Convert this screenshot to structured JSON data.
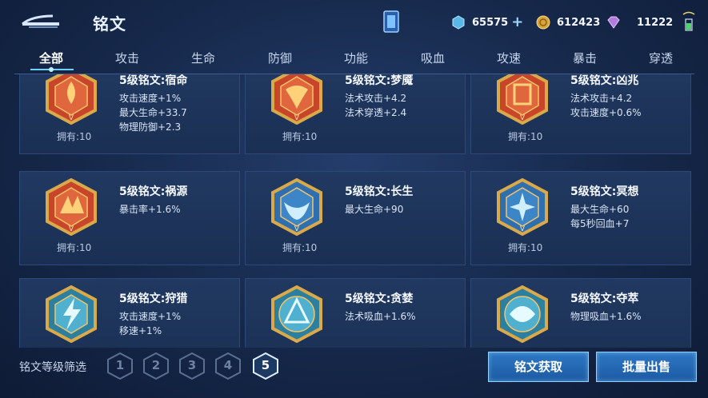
{
  "header": {
    "title": "铭文",
    "currencies": [
      {
        "name": "diamond-icon",
        "value": "65575"
      },
      {
        "name": "gold-coin-icon",
        "value": "612423"
      },
      {
        "name": "gem-icon",
        "value": "11222"
      }
    ]
  },
  "tabs": [
    "全部",
    "攻击",
    "生命",
    "防御",
    "功能",
    "吸血",
    "攻速",
    "暴击",
    "穿透"
  ],
  "active_tab": "全部",
  "runes": [
    {
      "name": "5级铭文:宿命",
      "attrs": [
        "攻击速度+1%",
        "最大生命+33.7",
        "物理防御+2.3"
      ],
      "owned": "拥有:10",
      "icon": "red-rune-icon"
    },
    {
      "name": "5级铭文:梦魇",
      "attrs": [
        "法术攻击+4.2",
        "法术穿透+2.4"
      ],
      "owned": "拥有:10",
      "icon": "red-rune-icon"
    },
    {
      "name": "5级铭文:凶兆",
      "attrs": [
        "法术攻击+4.2",
        "攻击速度+0.6%"
      ],
      "owned": "拥有:10",
      "icon": "red-rune-icon"
    },
    {
      "name": "5级铭文:祸源",
      "attrs": [
        "暴击率+1.6%"
      ],
      "owned": "拥有:10",
      "icon": "red-rune-icon"
    },
    {
      "name": "5级铭文:长生",
      "attrs": [
        "最大生命+90"
      ],
      "owned": "拥有:10",
      "icon": "blue-rune-icon"
    },
    {
      "name": "5级铭文:冥想",
      "attrs": [
        "最大生命+60",
        "每5秒回血+7"
      ],
      "owned": "拥有:10",
      "icon": "blue-rune-icon"
    },
    {
      "name": "5级铭文:狩猎",
      "attrs": [
        "攻击速度+1%",
        "移速+1%"
      ],
      "owned": "",
      "icon": "cyan-rune-icon"
    },
    {
      "name": "5级铭文:贪婪",
      "attrs": [
        "法术吸血+1.6%"
      ],
      "owned": "",
      "icon": "cyan-rune-icon"
    },
    {
      "name": "5级铭文:夺萃",
      "attrs": [
        "物理吸血+1.6%"
      ],
      "owned": "",
      "icon": "cyan-rune-icon"
    }
  ],
  "footer": {
    "filter_label": "铭文等级筛选",
    "levels": [
      "1",
      "2",
      "3",
      "4",
      "5"
    ],
    "selected_level": "5",
    "obtain_button": "铭文获取",
    "sell_button": "批量出售"
  },
  "colors": {
    "accent": "#6fd0ff",
    "red_rune": "#c8452a",
    "blue_rune": "#2f6fb0",
    "cyan_rune": "#4fb0cf",
    "gold_frame": "#d9a94a"
  }
}
